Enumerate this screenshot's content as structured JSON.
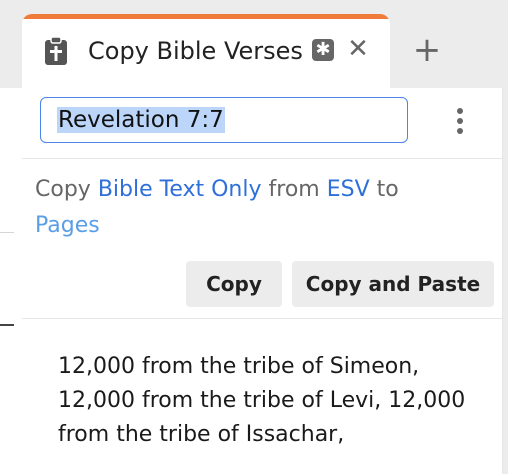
{
  "tab": {
    "title": "Copy Bible Verses",
    "badge_symbol": "✱",
    "close_symbol": "✕",
    "add_symbol": "+",
    "accent_color": "#f07a3a"
  },
  "reference_input": {
    "value": "Revelation 7:7"
  },
  "copy_settings": {
    "word_copy": "Copy",
    "content_type": "Bible Text Only",
    "word_from": "from",
    "version": "ESV",
    "word_to": "to",
    "destination": "Pages"
  },
  "buttons": {
    "copy": "Copy",
    "copy_and_paste": "Copy and Paste"
  },
  "preview": {
    "text": "12,000 from the tribe of Simeon, 12,000 from the tribe of Levi, 12,000 from the tribe of Issachar,"
  },
  "colors": {
    "link": "#2f6fd8",
    "input_border": "#4a86e8",
    "selection": "#bcd6fa"
  },
  "icons": {
    "tab_icon": "clipboard-cross-icon",
    "menu": "kebab-menu-icon"
  }
}
